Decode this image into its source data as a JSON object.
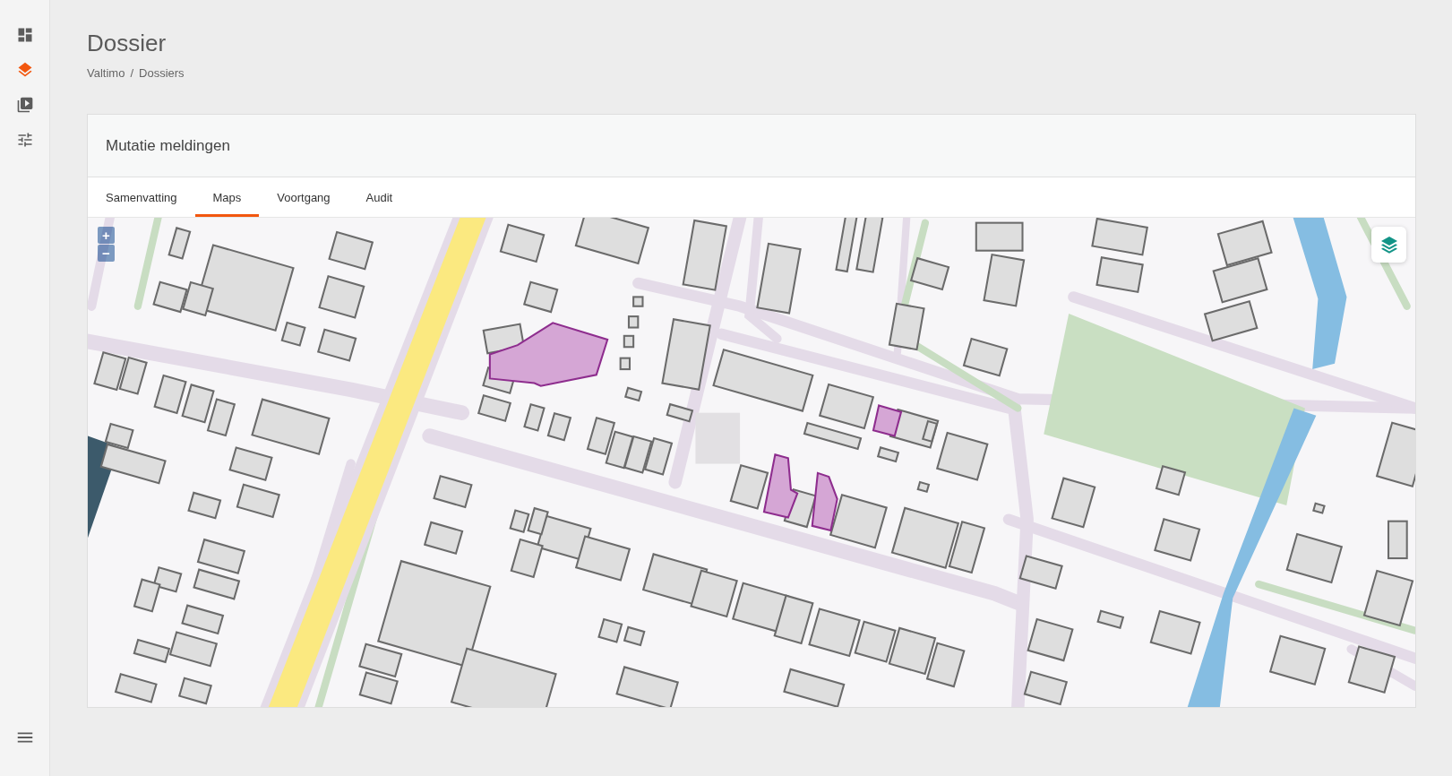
{
  "sidebar": {
    "items": [
      {
        "selected": false
      },
      {
        "selected": true
      },
      {
        "selected": false
      },
      {
        "selected": false
      }
    ]
  },
  "page": {
    "title": "Dossier",
    "breadcrumb": [
      "Valtimo",
      "Dossiers"
    ],
    "breadcrumb_separator": "/"
  },
  "card": {
    "title": "Mutatie meldingen",
    "tabs": [
      {
        "label": "Samenvatting",
        "selected": false
      },
      {
        "label": "Maps",
        "selected": true
      },
      {
        "label": "Voortgang",
        "selected": false
      },
      {
        "label": "Audit",
        "selected": false
      }
    ],
    "map": {
      "zoom_in": "+",
      "zoom_out": "−"
    }
  }
}
